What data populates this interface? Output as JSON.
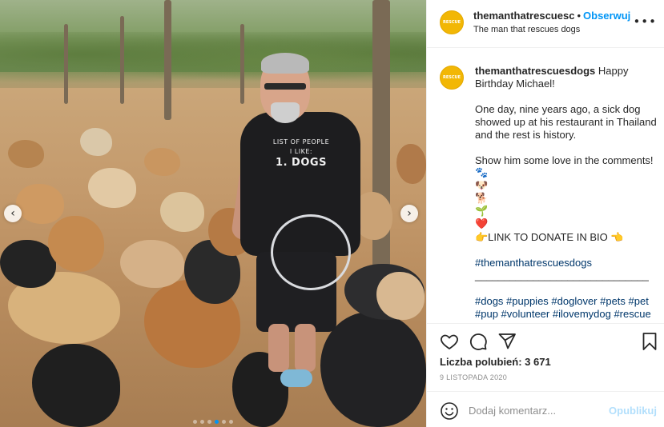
{
  "post": {
    "username_truncated": "themanthatrescuesc",
    "username": "themanthatrescuesdogs",
    "follow_label": "Obserwuj",
    "subtitle": "The man that rescues dogs",
    "avatar_text": "RESCUE",
    "shirt_text_small1": "LIST OF PEOPLE",
    "shirt_text_small2": "I LIKE:",
    "shirt_text_big": "1. DOGS"
  },
  "caption": {
    "first_line": "Happy Birthday Michael!",
    "paragraph2": "One day, nine years ago, a sick dog showed up at his restaurant in Thailand and the rest is history.",
    "paragraph3": "Show him some love in the comments!",
    "emojis": [
      "🐾",
      "🐶",
      "🐕",
      "🌱",
      "❤️"
    ],
    "donate": "👉LINK TO DONATE IN BIO 👈",
    "hashtag_main": "#themanthatrescuesdogs",
    "divider": "______________________________",
    "hashtags": "#dogs #puppies #doglover #pets #pet #pup #volunteer #ilovemydog #rescue"
  },
  "stats": {
    "likes": "Liczba polubień: 3 671",
    "date": "9 LISTOPADA 2020"
  },
  "comment": {
    "placeholder": "Dodaj komentarz...",
    "publish_label": "Opublikuj"
  },
  "carousel": {
    "prev": "‹",
    "next": "›",
    "slide_count": 6,
    "active_slide": 4
  },
  "colors": {
    "accent": "#0095f6",
    "publish_disabled": "#b2dffc",
    "hashtag": "#00376b",
    "avatar": "#f2b705"
  },
  "icons": {
    "more": "more-options-icon",
    "like": "heart-icon",
    "comment": "comment-icon",
    "share": "share-icon",
    "save": "bookmark-icon",
    "emoji": "emoji-icon"
  }
}
